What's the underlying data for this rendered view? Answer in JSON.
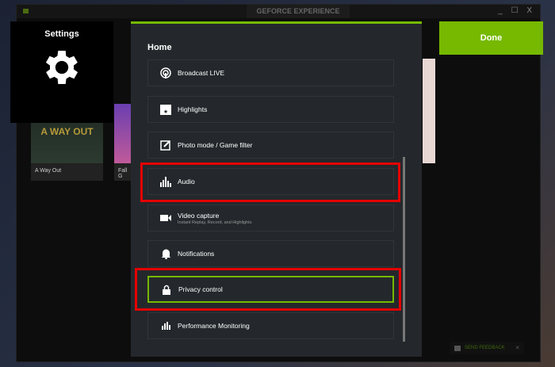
{
  "window": {
    "title": "GEFORCE EXPERIENCE",
    "controls": "_ ☐ X"
  },
  "games": [
    {
      "name": "A Way Out",
      "art_text": "A WAY OUT"
    },
    {
      "name": "Fall G"
    }
  ],
  "settings": {
    "title": "Settings"
  },
  "panel": {
    "heading": "Home",
    "items": [
      {
        "label": "Broadcast LIVE",
        "icon": "broadcast-icon"
      },
      {
        "label": "Highlights",
        "icon": "clapper-icon"
      },
      {
        "label": "Photo mode / Game filter",
        "icon": "photo-edit-icon"
      },
      {
        "label": "Audio",
        "icon": "audio-icon"
      },
      {
        "label": "Video capture",
        "sub": "Instant Replay, Record, and Highlights",
        "icon": "camera-icon"
      },
      {
        "label": "Notifications",
        "icon": "bell-icon"
      },
      {
        "label": "Privacy control",
        "icon": "lock-icon"
      },
      {
        "label": "Performance Monitoring",
        "icon": "bar-chart-icon"
      }
    ]
  },
  "done": "Done",
  "feedback": {
    "label": "SEND FEEDBACK",
    "close": "✕"
  },
  "colors": {
    "accent": "#76b900",
    "highlight": "#e50000"
  }
}
